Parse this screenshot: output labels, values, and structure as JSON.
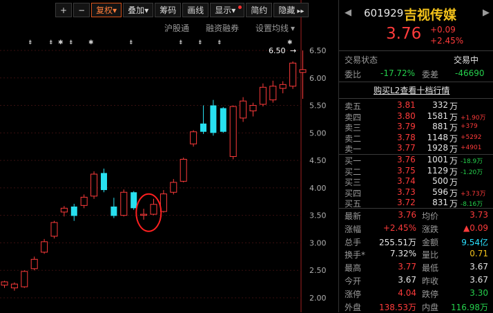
{
  "toolbar": {
    "buttons": [
      "+",
      "−",
      "复权",
      "叠加",
      "筹码",
      "画线",
      "显示",
      "简约",
      "隐藏"
    ],
    "fuquan_arrow": "▾",
    "diejia_arrow": "▾",
    "xianshi_arrow": "▾",
    "more": "▸▸"
  },
  "subbar": {
    "items": [
      "沪股通",
      "融资融券",
      "设置均线"
    ],
    "setting_arrow": "▾"
  },
  "quote": {
    "code": "601929",
    "name": "吉视传媒",
    "price": "3.76",
    "change": "+0.09",
    "change_pct": "+2.45%",
    "nav_left": "◀",
    "nav_right": "▶"
  },
  "status": {
    "label": "交易状态",
    "value": "交易中",
    "weibi_label": "委比",
    "weibi": "-17.72%",
    "weicha_label": "委差",
    "weicha": "-46690",
    "l2_link": "购买L2查看十档行情"
  },
  "asks": [
    {
      "label": "卖五",
      "price": "3.81",
      "vol": "332",
      "unit": "万",
      "delta": ""
    },
    {
      "label": "卖四",
      "price": "3.80",
      "vol": "1581",
      "unit": "万",
      "delta": "+1.90万"
    },
    {
      "label": "卖三",
      "price": "3.79",
      "vol": "881",
      "unit": "万",
      "delta": "+379"
    },
    {
      "label": "卖二",
      "price": "3.78",
      "vol": "1148",
      "unit": "万",
      "delta": "+5292"
    },
    {
      "label": "卖一",
      "price": "3.77",
      "vol": "1928",
      "unit": "万",
      "delta": "+4901"
    }
  ],
  "bids": [
    {
      "label": "买一",
      "price": "3.76",
      "vol": "1001",
      "unit": "万",
      "delta": "-18.9万"
    },
    {
      "label": "买二",
      "price": "3.75",
      "vol": "1129",
      "unit": "万",
      "delta": "-1.20万"
    },
    {
      "label": "买三",
      "price": "3.74",
      "vol": "500",
      "unit": "万",
      "delta": ""
    },
    {
      "label": "买四",
      "price": "3.73",
      "vol": "596",
      "unit": "万",
      "delta": "+3.73万"
    },
    {
      "label": "买五",
      "price": "3.72",
      "vol": "831",
      "unit": "万",
      "delta": "-8.16万"
    }
  ],
  "stats": [
    {
      "l1": "最新",
      "v1": "3.76",
      "l2": "均价",
      "v2": "3.73"
    },
    {
      "l1": "涨幅",
      "v1": "+2.45%",
      "l2": "涨跌",
      "v2": "▲0.09"
    },
    {
      "l1": "总手",
      "v1": "255.51万",
      "l2": "金额",
      "v2": "9.54亿"
    },
    {
      "l1": "换手*",
      "v1": "7.32%",
      "l2": "量比",
      "v2": "0.71"
    },
    {
      "l1": "最高",
      "v1": "3.77",
      "l2": "最低",
      "v2": "3.67"
    },
    {
      "l1": "今开",
      "v1": "3.67",
      "l2": "昨收",
      "v2": "3.67"
    },
    {
      "l1": "涨停",
      "v1": "4.04",
      "l2": "跌停",
      "v2": "3.30"
    },
    {
      "l1": "外盘",
      "v1": "138.53万",
      "l2": "内盘",
      "v2": "116.98万"
    }
  ],
  "chart_data": {
    "type": "candlestick",
    "y_ticks": [
      "6.50",
      "6.00",
      "5.50",
      "5.00",
      "4.50",
      "4.00",
      "3.50",
      "3.00",
      "2.50",
      "2.00"
    ],
    "ylim": [
      2.0,
      6.5
    ],
    "max_label": "6.50",
    "max_arrow": "→",
    "event_markers": [
      "⇟",
      "⇟",
      "✱",
      "⇟",
      "✱",
      "⇟",
      "⇟",
      "⇟",
      "⇟",
      "✱",
      "⇟",
      "⇟"
    ],
    "candles": [
      {
        "o": 2.23,
        "c": 2.29,
        "h": 2.31,
        "l": 2.18,
        "up": false
      },
      {
        "o": 2.18,
        "c": 2.25,
        "h": 2.28,
        "l": 2.13,
        "up": true
      },
      {
        "o": 2.2,
        "c": 2.48,
        "h": 2.5,
        "l": 2.18,
        "up": true
      },
      {
        "o": 2.53,
        "c": 2.7,
        "h": 2.75,
        "l": 2.5,
        "up": true
      },
      {
        "o": 2.83,
        "c": 3.02,
        "h": 3.07,
        "l": 2.8,
        "up": true
      },
      {
        "o": 3.12,
        "c": 3.37,
        "h": 3.4,
        "l": 3.08,
        "up": true
      },
      {
        "o": 3.56,
        "c": 3.63,
        "h": 3.67,
        "l": 3.48,
        "up": true
      },
      {
        "o": 3.66,
        "c": 3.49,
        "h": 3.71,
        "l": 3.4,
        "up": false
      },
      {
        "o": 3.68,
        "c": 3.83,
        "h": 3.88,
        "l": 3.63,
        "up": true
      },
      {
        "o": 3.85,
        "c": 4.25,
        "h": 4.3,
        "l": 3.8,
        "up": true
      },
      {
        "o": 4.27,
        "c": 3.96,
        "h": 4.35,
        "l": 3.92,
        "up": false
      },
      {
        "o": 3.66,
        "c": 3.49,
        "h": 3.82,
        "l": 3.45,
        "up": false
      },
      {
        "o": 3.5,
        "c": 3.92,
        "h": 3.97,
        "l": 3.48,
        "up": true
      },
      {
        "o": 3.92,
        "c": 3.63,
        "h": 3.94,
        "l": 3.6,
        "up": false
      },
      {
        "o": 3.5,
        "c": 3.52,
        "h": 3.62,
        "l": 3.42,
        "up": true
      },
      {
        "o": 3.52,
        "c": 3.7,
        "h": 3.8,
        "l": 3.5,
        "up": true
      },
      {
        "o": 3.57,
        "c": 3.89,
        "h": 3.96,
        "l": 3.55,
        "up": true
      },
      {
        "o": 3.92,
        "c": 4.1,
        "h": 4.16,
        "l": 3.88,
        "up": true
      },
      {
        "o": 4.12,
        "c": 4.52,
        "h": 4.55,
        "l": 4.1,
        "up": true
      },
      {
        "o": 4.8,
        "c": 5.02,
        "h": 5.05,
        "l": 4.75,
        "up": true
      },
      {
        "o": 5.17,
        "c": 5.02,
        "h": 5.5,
        "l": 4.98,
        "up": false
      },
      {
        "o": 5.5,
        "c": 5.0,
        "h": 5.6,
        "l": 4.95,
        "up": false
      },
      {
        "o": 5.45,
        "c": 5.02,
        "h": 5.47,
        "l": 5.0,
        "up": false
      },
      {
        "o": 4.57,
        "c": 5.48,
        "h": 5.5,
        "l": 4.52,
        "up": true
      },
      {
        "o": 5.27,
        "c": 5.58,
        "h": 5.65,
        "l": 5.2,
        "up": true
      },
      {
        "o": 5.4,
        "c": 5.5,
        "h": 5.55,
        "l": 5.3,
        "up": true
      },
      {
        "o": 5.52,
        "c": 5.83,
        "h": 5.9,
        "l": 5.48,
        "up": true
      },
      {
        "o": 5.6,
        "c": 5.85,
        "h": 5.95,
        "l": 5.55,
        "up": true
      },
      {
        "o": 5.81,
        "c": 5.88,
        "h": 5.94,
        "l": 5.72,
        "up": false
      },
      {
        "o": 5.85,
        "c": 6.27,
        "h": 6.3,
        "l": 5.8,
        "up": true
      },
      {
        "o": 6.1,
        "c": 6.15,
        "h": 6.5,
        "l": 5.62,
        "up": true
      }
    ]
  }
}
